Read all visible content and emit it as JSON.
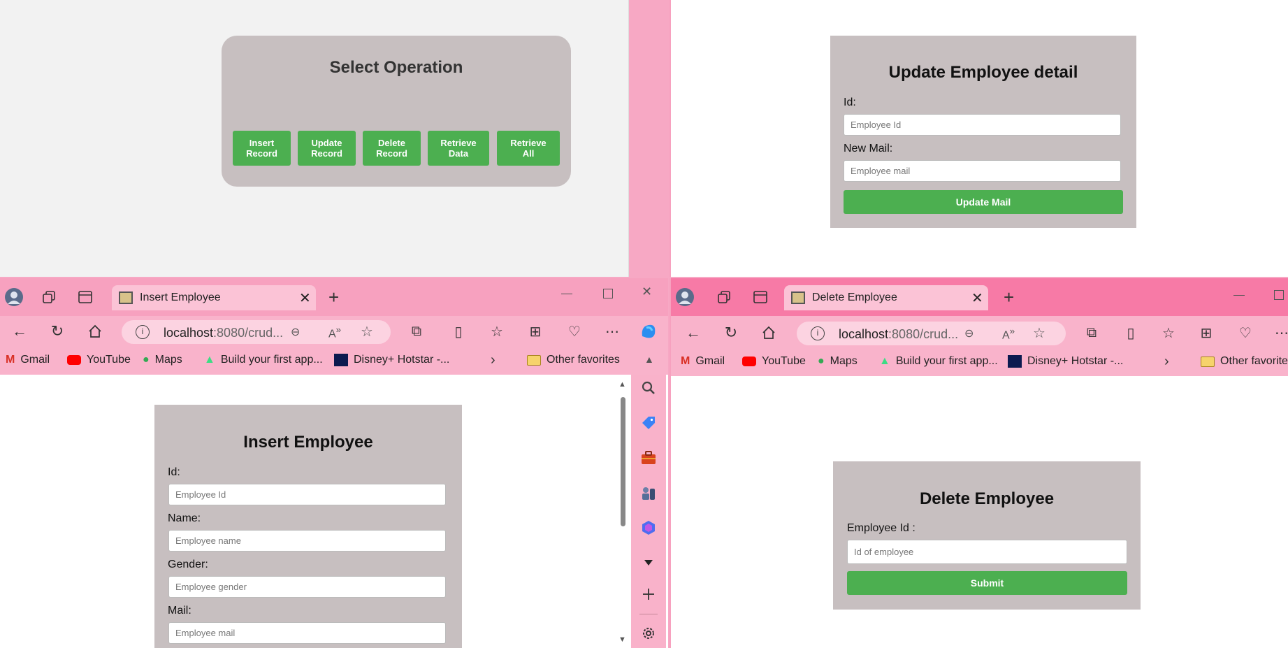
{
  "select_window": {
    "title": "Select Operation",
    "buttons": [
      "Insert\nRecord",
      "Update\nRecord",
      "Delete\nRecord",
      "Retrieve\nData",
      "Retrieve\nAll"
    ]
  },
  "update_window": {
    "title": "Update Employee detail",
    "id_label": "Id:",
    "id_placeholder": "Employee Id",
    "mail_label": "New Mail:",
    "mail_placeholder": "Employee mail",
    "button": "Update Mail"
  },
  "insert_window": {
    "tab_title": "Insert Employee",
    "url_host": "localhost",
    "url_rest": ":8080/crud...",
    "title": "Insert Employee",
    "id_label": "Id:",
    "id_placeholder": "Employee Id",
    "name_label": "Name:",
    "name_placeholder": "Employee name",
    "gender_label": "Gender:",
    "gender_placeholder": "Employee gender",
    "mail_label": "Mail:",
    "mail_placeholder": "Employee mail"
  },
  "delete_window": {
    "tab_title": "Delete Employee",
    "url_host": "localhost",
    "url_rest": ":8080/crud...",
    "title": "Delete Employee",
    "id_label": "Employee Id :",
    "id_placeholder": "Id of employee",
    "button": "Submit"
  },
  "bookmarks": {
    "gmail": "Gmail",
    "youtube": "YouTube",
    "maps": "Maps",
    "build": "Build your first app...",
    "hotstar": "Disney+ Hotstar -...",
    "other": "Other favorites"
  },
  "colors": {
    "accent_green": "#4caf50",
    "card_gray": "#c7bfc0",
    "chrome_pink": "#f7a1bf"
  }
}
